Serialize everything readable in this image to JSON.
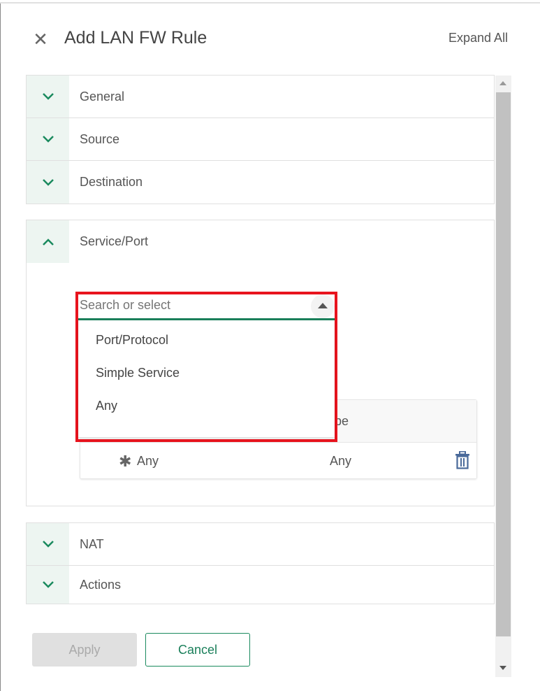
{
  "header": {
    "title": "Add LAN FW Rule",
    "expand_all": "Expand All",
    "close_icon": "close-icon"
  },
  "sections_top": [
    {
      "label": "General"
    },
    {
      "label": "Source"
    },
    {
      "label": "Destination"
    }
  ],
  "service": {
    "label": "Service/Port",
    "search": {
      "placeholder": "Search or select",
      "value": ""
    },
    "options": [
      "Port/Protocol",
      "Simple Service",
      "Any"
    ],
    "table": {
      "header_type": "Type",
      "rows": [
        {
          "name": "Any",
          "type": "Any"
        }
      ]
    }
  },
  "sections_bottom": [
    {
      "label": "NAT"
    },
    {
      "label": "Actions"
    }
  ],
  "buttons": {
    "apply": "Apply",
    "cancel": "Cancel"
  },
  "colors": {
    "accent": "#1a7f5a",
    "highlight": "#e8141e",
    "trash": "#4a6a9a"
  }
}
